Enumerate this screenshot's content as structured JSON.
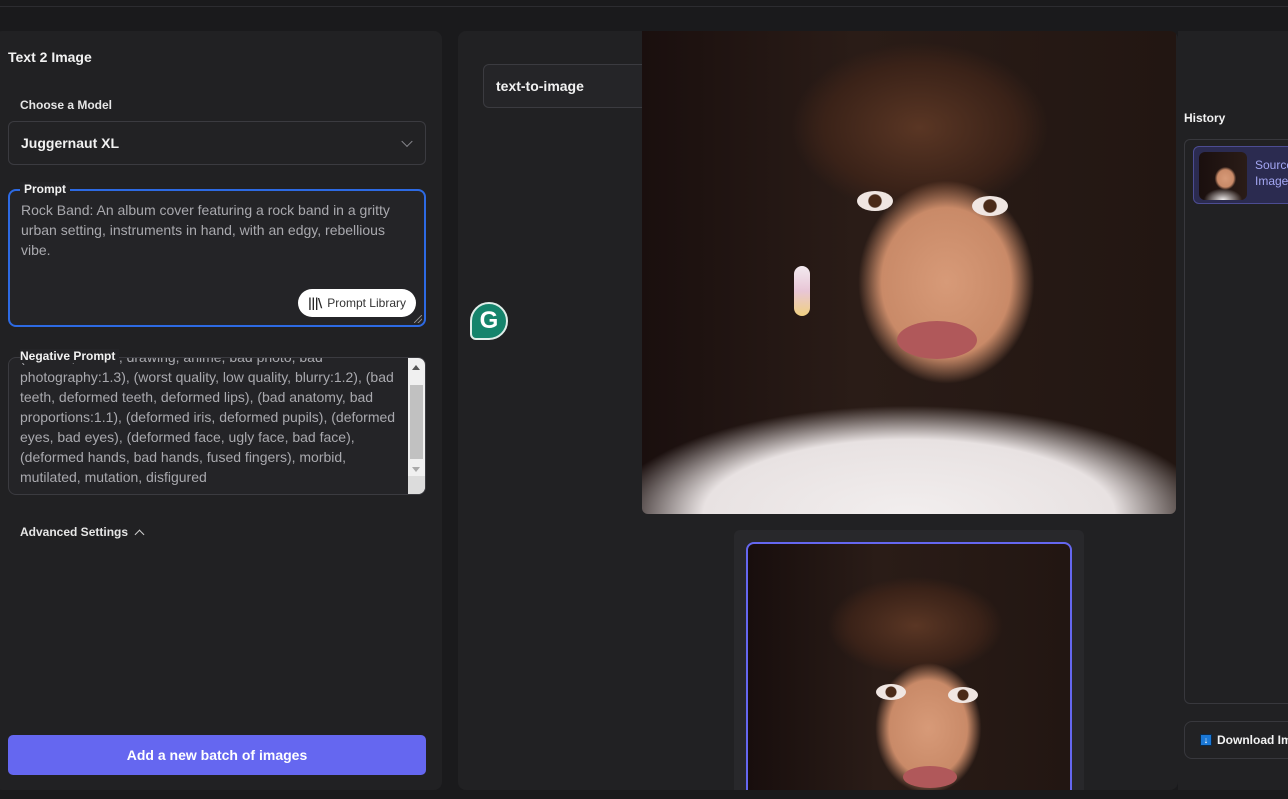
{
  "left_panel": {
    "title": "Text 2 Image",
    "model": {
      "label": "Choose a Model",
      "selected": "Juggernaut XL"
    },
    "prompt": {
      "label": "Prompt",
      "value": "Rock Band: An album cover featuring a rock band in a gritty urban setting, instruments in hand, with an edgy, rebellious vibe.",
      "library_button": "Prompt Library",
      "library_icon": "library-icon"
    },
    "negative_prompt": {
      "label": "Negative Prompt",
      "value": "(cartoon, render, drawing, anime, bad photo, bad photography:1.3), (worst quality, low quality, blurry:1.2), (bad teeth, deformed teeth, deformed lips), (bad anatomy, bad proportions:1.1), (deformed iris, deformed pupils), (deformed eyes, bad eyes), (deformed face, ugly face, bad face), (deformed hands, bad hands, fused fingers), morbid, mutilated, mutation, disfigured"
    },
    "advanced_settings": "Advanced Settings",
    "submit_button": "Add a new batch of images"
  },
  "center_panel": {
    "mode": "text-to-image",
    "grammarly_icon": "G",
    "main_image_alt": "Generated portrait of a woman with dark updo hair, pearl earring and white fur collar",
    "thumbnail_alt": "Selected thumbnail of generated portrait"
  },
  "right_panel": {
    "history_title": "History",
    "history_items": [
      {
        "label": "Source Image"
      }
    ],
    "download_button": "Download Images",
    "download_icon": "↓"
  },
  "colors": {
    "accent": "#6567f0",
    "focus_border": "#2d6ae3",
    "panel_bg": "#212123",
    "page_bg": "#1a1a1c"
  }
}
